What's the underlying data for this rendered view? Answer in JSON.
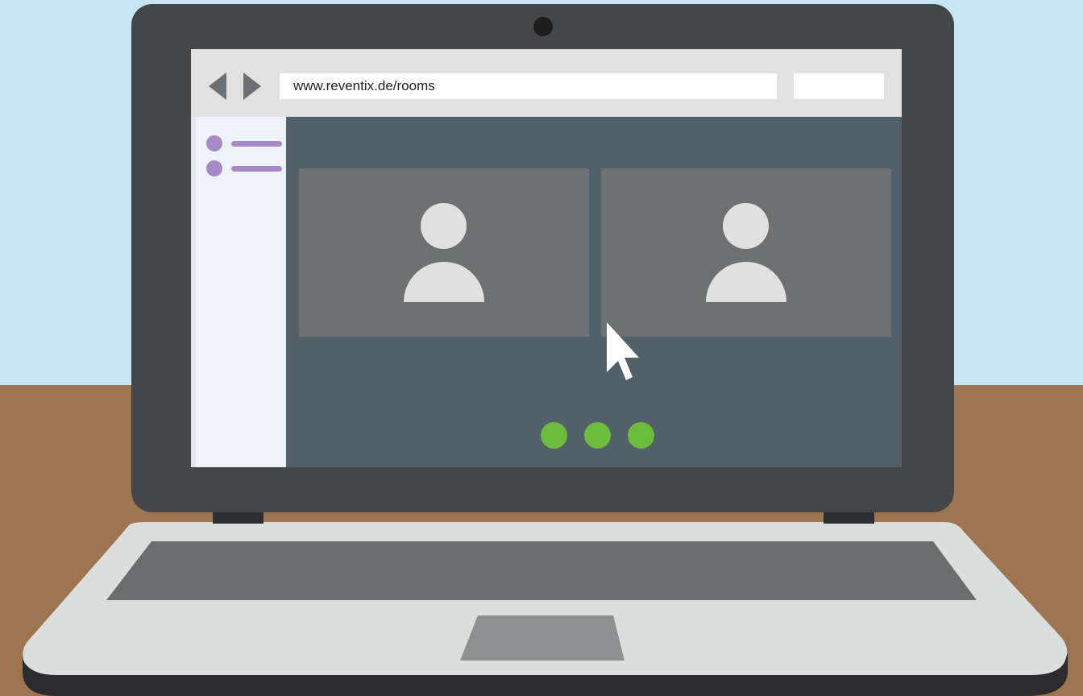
{
  "browser": {
    "url": "www.reventix.de/rooms"
  },
  "sidebar": {
    "items": [
      {
        "icon": "dot"
      },
      {
        "icon": "dot"
      }
    ]
  },
  "participants": [
    {
      "icon": "person-icon"
    },
    {
      "icon": "person-icon"
    }
  ],
  "controls": {
    "dots": 3
  },
  "colors": {
    "sky": "#c8e5f4",
    "desk": "#9d7651",
    "bezel": "#454648",
    "content": "#526069",
    "accent_purple": "#a58ac7",
    "accent_green": "#6dbc3c"
  }
}
